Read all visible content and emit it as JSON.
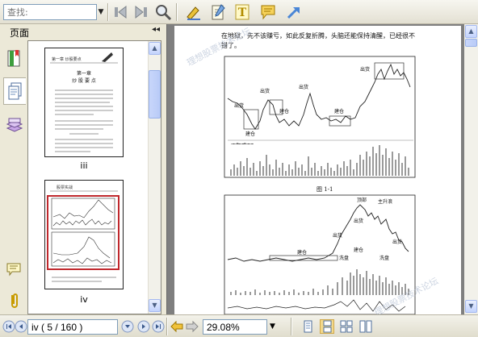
{
  "toolbar": {
    "search": {
      "placeholder": "查找:",
      "value": ""
    },
    "buttons": [
      {
        "name": "find-previous-button",
        "icon": "find-prev-icon"
      },
      {
        "name": "find-next-button",
        "icon": "find-next-icon"
      },
      {
        "name": "search-magnifier-button",
        "icon": "magnifier-icon"
      },
      {
        "name": "highlight-button",
        "icon": "highlighter-icon"
      },
      {
        "name": "notes-button",
        "icon": "notepad-icon"
      },
      {
        "name": "text-tool-button",
        "icon": "text-t-icon"
      },
      {
        "name": "comment-button",
        "icon": "speech-bubble-icon"
      },
      {
        "name": "arrow-tool-button",
        "icon": "arrow-icon"
      }
    ]
  },
  "left_panel": {
    "title": "页面",
    "collapse_glyph": "◂◂",
    "thumbnails": [
      {
        "label": "iii",
        "heading": "第一章",
        "subheading": "炒 股 要 点",
        "header": "第一章 炒股要点"
      },
      {
        "label": "iv",
        "header": "股票实战"
      }
    ]
  },
  "document": {
    "text_line1": "在地狱，先不该赚亏，如此反复折腾，头脑还能保持清醒，已经很不",
    "text_line2": "错了。",
    "figure1": {
      "caption": "图 1-1",
      "annotations": [
        "出货",
        "出货",
        "出货",
        "建仓",
        "建仓",
        "建仓",
        "出货"
      ]
    },
    "figure2": {
      "annotations": [
        "建仓",
        "出货",
        "出货",
        "洗盘",
        "洗盘",
        "建仓",
        "出货",
        "主升浪",
        "顶部"
      ]
    },
    "watermark": "理想股票技术论坛"
  },
  "statusbar": {
    "page_value": "iv ( 5 / 160 )",
    "zoom_value": "29.08%"
  },
  "colors": {
    "chrome": "#ece9d8",
    "highlight_border": "#c0282d",
    "doc_background": "#7f7f7f"
  }
}
